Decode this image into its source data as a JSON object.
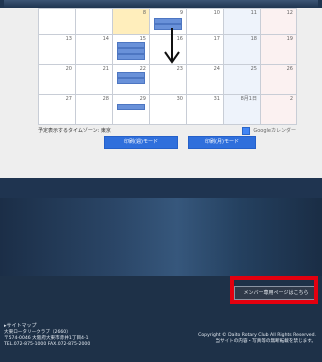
{
  "calendar": {
    "weeks": [
      [
        "",
        "",
        "",
        "8",
        "9",
        "10",
        "11",
        "12"
      ],
      [
        "13",
        "14",
        "15",
        "16",
        "17",
        "18",
        "19"
      ],
      [
        "20",
        "21",
        "22",
        "23",
        "24",
        "25",
        "26"
      ],
      [
        "27",
        "28",
        "29",
        "30",
        "31",
        "8月1日",
        "2"
      ]
    ],
    "timezone_note": "予定表示するタイムゾーン: 東京",
    "google_calendar_label": "Googleカレンダー",
    "print_week_label": "印刷(週)モード",
    "print_month_label": "印刷(月)モード"
  },
  "footer": {
    "member_page_button": "メンバー専用ページはこちら",
    "sitemap": "▸サイトマップ",
    "address_lines": [
      "大東ロータリークラブ（2660）",
      "〒574-0046 大阪府大東市赤井1丁目4-1",
      "TEL.072-875-1000  FAX.072-875-2000"
    ],
    "copyright_lines": [
      "Copyright © Daito Rotary Club All Rights Reserved.",
      "当サイトの内容・写真等の無断転載を禁じます。"
    ]
  },
  "colors": {
    "highlight": "#e3000f",
    "print_button": "#2f6fdc",
    "footer_bg": "#1e3148"
  }
}
